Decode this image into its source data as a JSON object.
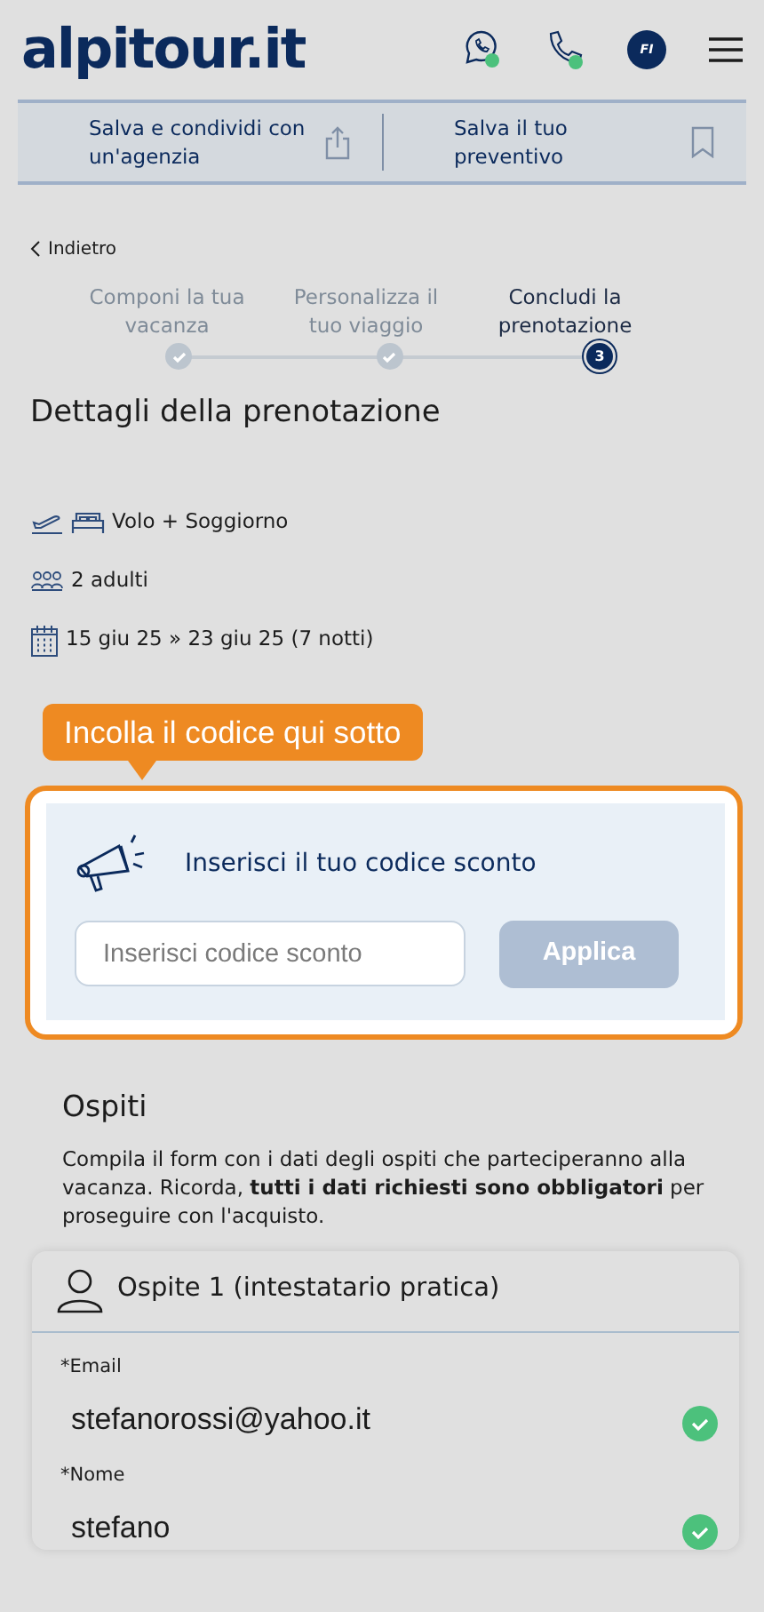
{
  "header": {
    "logo": "alpitour.it",
    "avatar": "FI"
  },
  "actions": [
    {
      "label": "Salva e condividi con un'agenzia",
      "kind": "share"
    },
    {
      "label": "Salva il tuo preventivo",
      "kind": "bookmark"
    }
  ],
  "back": "Indietro",
  "steps": [
    {
      "label": "Componi la tua vacanza",
      "selected": false
    },
    {
      "label": "Personalizza il tuo viaggio",
      "selected": false
    },
    {
      "label": "Concludi la prenotazione",
      "selected": true,
      "number": "3"
    }
  ],
  "title": "Dettagli della prenotazione",
  "details": [
    {
      "kind": "trip",
      "text": "Volo + Soggiorno"
    },
    {
      "kind": "people",
      "text": "2 adulti"
    },
    {
      "kind": "dates",
      "text": "15 giu 25 » 23 giu 25 (7 notti)"
    }
  ],
  "tooltip": "Incolla il codice qui sotto",
  "discount": {
    "title": "Inserisci il tuo codice sconto",
    "placeholder": "Inserisci codice sconto",
    "button": "Applica",
    "button_disabled": true
  },
  "guests": {
    "title": "Ospiti",
    "text": "Compila il form con i dati degli ospiti che parteciperanno alla vacanza. Ricorda, **tutti i dati richiesti sono obbligatori** per proseguire con l'acquisto.",
    "card_title": "Ospite 1 (intestatario pratica)",
    "fields": [
      {
        "label": "*Email",
        "value": "stefanorossi@yahoo.it",
        "valid": true
      },
      {
        "label": "*Nome",
        "value": "stefano",
        "valid": true
      }
    ]
  }
}
